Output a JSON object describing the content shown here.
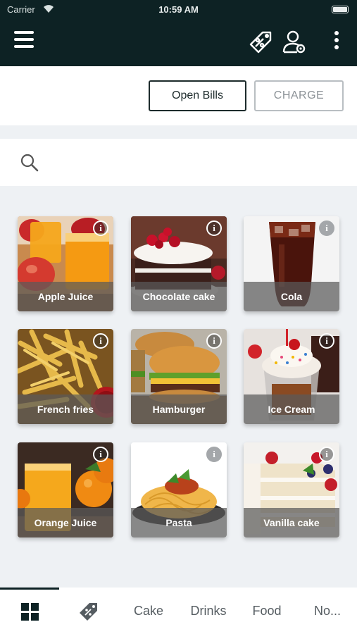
{
  "status_bar": {
    "carrier": "Carrier",
    "time": "10:59 AM"
  },
  "header": {
    "icons": [
      "menu-icon",
      "discount-tag-icon",
      "user-settings-icon",
      "more-vertical-icon"
    ]
  },
  "actions": {
    "open_bills_label": "Open Bills",
    "charge_label": "CHARGE"
  },
  "search": {
    "placeholder": ""
  },
  "products": [
    {
      "name": "Apple Juice",
      "info": "i"
    },
    {
      "name": "Chocolate cake",
      "info": "i"
    },
    {
      "name": "Cola",
      "info": "i"
    },
    {
      "name": "French fries",
      "info": "i"
    },
    {
      "name": "Hamburger",
      "info": "i"
    },
    {
      "name": "Ice Cream",
      "info": "i"
    },
    {
      "name": "Orange Juice",
      "info": "i"
    },
    {
      "name": "Pasta",
      "info": "i"
    },
    {
      "name": "Vanilla cake",
      "info": "i"
    }
  ],
  "tabs": {
    "cake": "Cake",
    "drinks": "Drinks",
    "food": "Food",
    "more": "No..."
  },
  "colors": {
    "header_bg": "#0d2224",
    "accent": "#0d2224",
    "charge_disabled": "#8d9398"
  }
}
